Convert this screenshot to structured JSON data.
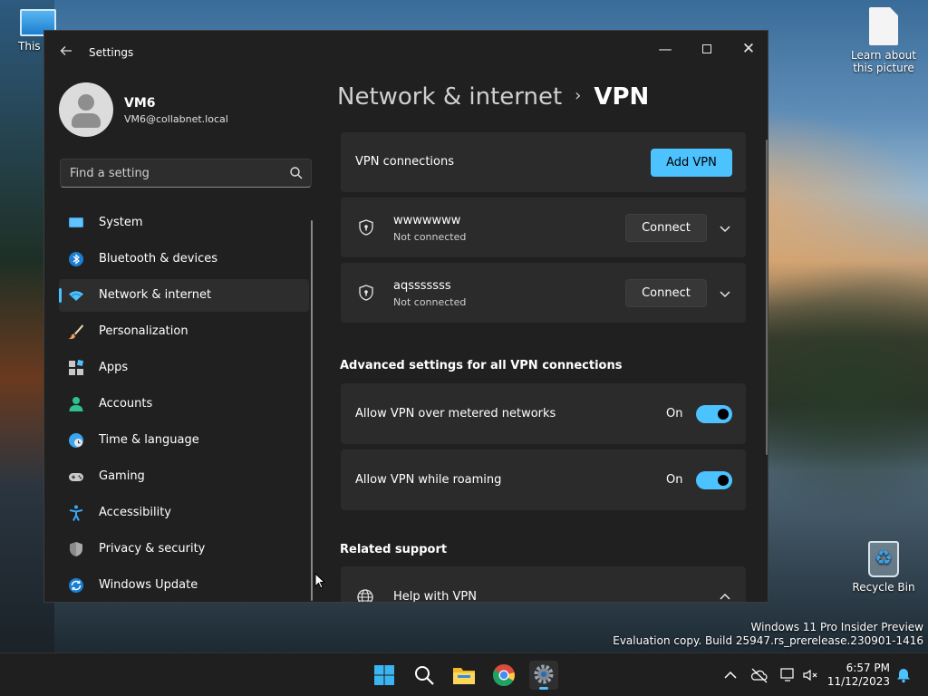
{
  "desktop": {
    "icons": {
      "this_pc": "This PC",
      "learn_line1": "Learn about",
      "learn_line2": "this picture",
      "recycle_bin": "Recycle Bin"
    },
    "watermark": {
      "line1": "Windows 11 Pro Insider Preview",
      "line2": "Evaluation copy. Build 25947.rs_prerelease.230901-1416"
    }
  },
  "window": {
    "title": "Settings",
    "controls": {
      "minimize": "—",
      "close": "✕"
    }
  },
  "profile": {
    "name": "VM6",
    "email": "VM6@collabnet.local"
  },
  "search": {
    "placeholder": "Find a setting"
  },
  "sidebar": {
    "items": [
      {
        "label": "System",
        "icon": "monitor-icon"
      },
      {
        "label": "Bluetooth & devices",
        "icon": "bluetooth-icon"
      },
      {
        "label": "Network & internet",
        "icon": "wifi-icon",
        "active": true
      },
      {
        "label": "Personalization",
        "icon": "brush-icon"
      },
      {
        "label": "Apps",
        "icon": "apps-icon"
      },
      {
        "label": "Accounts",
        "icon": "person-icon"
      },
      {
        "label": "Time & language",
        "icon": "globe-clock-icon"
      },
      {
        "label": "Gaming",
        "icon": "gamepad-icon"
      },
      {
        "label": "Accessibility",
        "icon": "accessibility-icon"
      },
      {
        "label": "Privacy & security",
        "icon": "shield-icon"
      },
      {
        "label": "Windows Update",
        "icon": "sync-icon"
      }
    ]
  },
  "breadcrumb": {
    "parent": "Network & internet",
    "separator": "›",
    "current": "VPN"
  },
  "vpn": {
    "connections_label": "VPN connections",
    "add_button": "Add VPN",
    "list": [
      {
        "name": "wwwwwww",
        "status": "Not connected",
        "action": "Connect"
      },
      {
        "name": "aqsssssss",
        "status": "Not connected",
        "action": "Connect"
      }
    ]
  },
  "advanced": {
    "heading": "Advanced settings for all VPN connections",
    "settings": [
      {
        "label": "Allow VPN over metered networks",
        "state": "On"
      },
      {
        "label": "Allow VPN while roaming",
        "state": "On"
      }
    ]
  },
  "related": {
    "heading": "Related support",
    "help_label": "Help with VPN"
  },
  "taskbar": {
    "time": "6:57 PM",
    "date": "11/12/2023"
  },
  "colors": {
    "accent": "#4cc2ff",
    "window_bg": "#202020",
    "card_bg": "#2b2b2b"
  }
}
